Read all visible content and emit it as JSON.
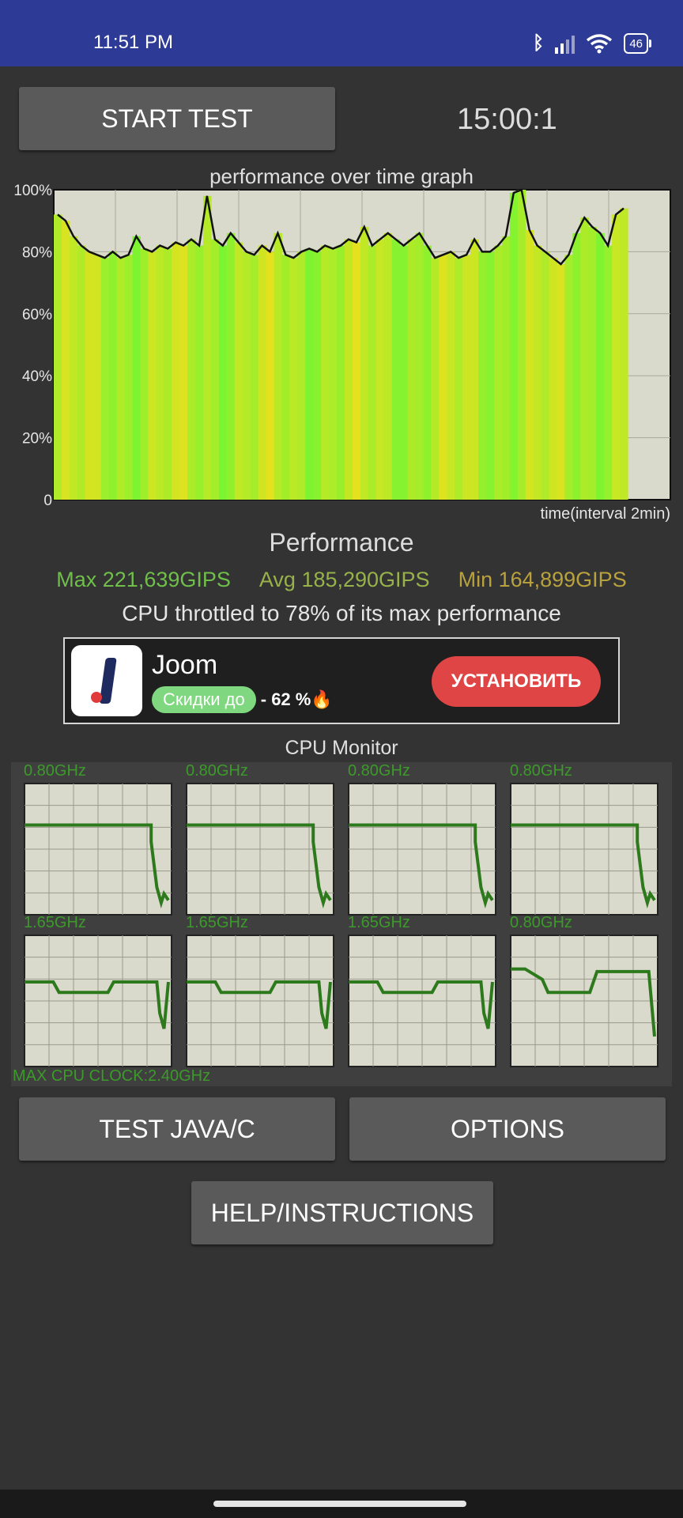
{
  "status_bar": {
    "time": "11:51 PM",
    "bluetooth_icon": "bluetooth-icon",
    "signal_icon": "signal-icon",
    "wifi_icon": "wifi-icon",
    "battery_level": "46"
  },
  "header": {
    "start_label": "START TEST",
    "timer": "15:00:1"
  },
  "graph": {
    "title": "performance over time graph",
    "x_label": "time(interval 2min)",
    "y_ticks": [
      "100%",
      "80%",
      "60%",
      "40%",
      "20%",
      "0"
    ]
  },
  "chart_data": {
    "type": "area",
    "title": "performance over time graph",
    "xlabel": "time(interval 2min)",
    "ylabel": "",
    "ylim": [
      0,
      100
    ],
    "y_ticks": [
      "0",
      "20%",
      "40%",
      "60%",
      "80%",
      "100%"
    ],
    "grid": true,
    "series": [
      {
        "values": [
          92,
          90,
          85,
          82,
          80,
          79,
          78,
          80,
          78,
          79,
          85,
          81,
          80,
          82,
          81,
          83,
          82,
          84,
          82,
          98,
          84,
          82,
          86,
          83,
          80,
          79,
          82,
          80,
          86,
          79,
          78,
          80,
          81,
          80,
          82,
          81,
          82,
          84,
          83,
          88,
          82,
          84,
          86,
          84,
          82,
          84,
          86,
          82,
          78,
          79,
          80,
          78,
          79,
          84,
          80,
          80,
          82,
          85,
          99,
          100,
          87,
          82,
          80,
          78,
          76,
          79,
          86,
          91,
          88,
          86,
          82,
          92,
          94
        ]
      }
    ]
  },
  "performance": {
    "heading": "Performance",
    "max": "Max 221,639GIPS",
    "avg": "Avg 185,290GIPS",
    "min": "Min 164,899GIPS",
    "throttle_text": "CPU throttled to 78% of its max performance"
  },
  "ad": {
    "app_name": "Joom",
    "promo_chip": "Скидки до",
    "promo_pct": "- 62 %🔥",
    "install_label": "УСТАНОВИТЬ"
  },
  "cpu_monitor": {
    "title": "CPU Monitor",
    "max_clock": "MAX CPU CLOCK:2.40GHz",
    "cores": [
      {
        "freq": "0.80GHz"
      },
      {
        "freq": "0.80GHz"
      },
      {
        "freq": "0.80GHz"
      },
      {
        "freq": "0.80GHz"
      },
      {
        "freq": "1.65GHz"
      },
      {
        "freq": "1.65GHz"
      },
      {
        "freq": "1.65GHz"
      },
      {
        "freq": "0.80GHz"
      }
    ]
  },
  "buttons": {
    "java_label": "TEST JAVA/C",
    "options_label": "OPTIONS",
    "help_label": "HELP/INSTRUCTIONS"
  },
  "colors": {
    "status_bar": "#2d3a96",
    "background": "#333333",
    "button": "#5a5a5a",
    "graph_bg": "#d9d9cc",
    "cpu_line": "#2d7a1c",
    "ad_install": "#e04545"
  }
}
